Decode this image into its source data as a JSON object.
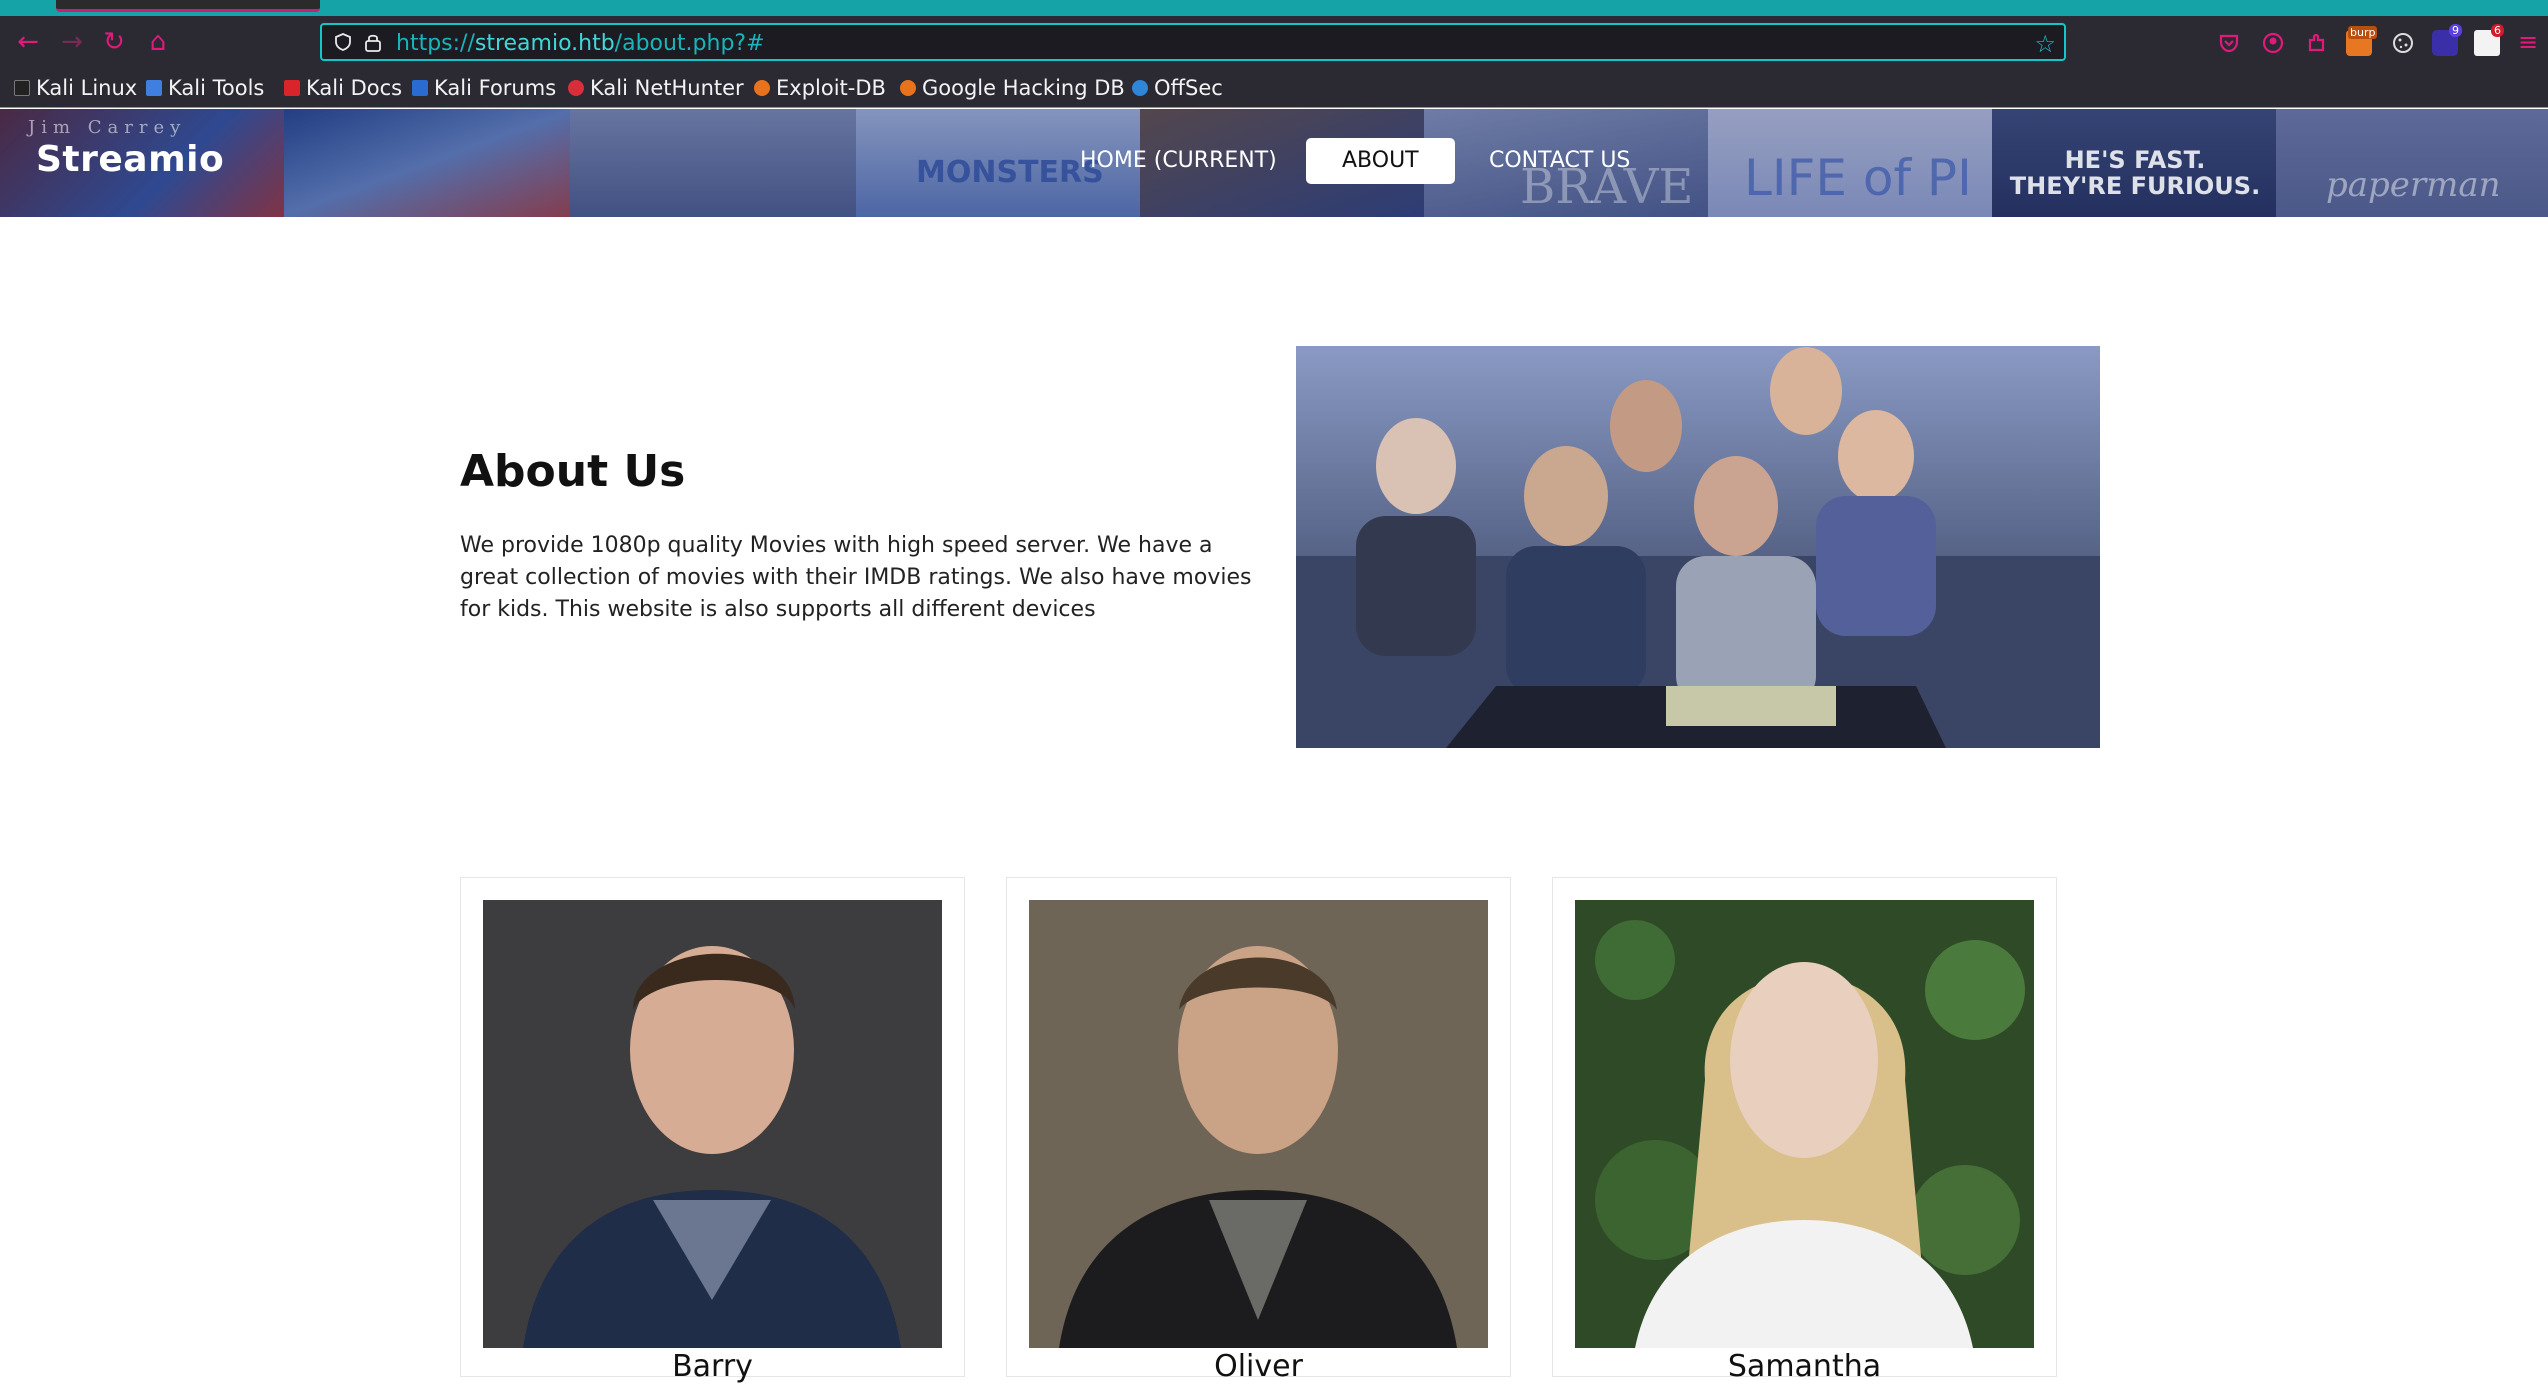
{
  "browser": {
    "url_scheme": "https://",
    "url_host": "streamio.htb",
    "url_path": "/about.php?#",
    "bookmarks": [
      "Kali Linux",
      "Kali Tools",
      "Kali Docs",
      "Kali Forums",
      "Kali NetHunter",
      "Exploit-DB",
      "Google Hacking DB",
      "OffSec"
    ],
    "ext_badges": {
      "burp": "burp",
      "badge_a": "9",
      "badge_b": "6"
    }
  },
  "header": {
    "brand": "Streamio",
    "nav": [
      "HOME (CURRENT)",
      "ABOUT",
      "CONTACT US"
    ],
    "poster_texts": [
      "Jim Carrey",
      "MONSTERS",
      "BRAVE",
      "LIFE of PI",
      "HE'S FAST. THEY'RE FURIOUS.",
      "paperman"
    ]
  },
  "about": {
    "title": "About Us",
    "text": "We provide 1080p quality Movies with high speed server. We have a great collection of movies with their IMDB ratings. We also have movies for kids. This website is also supports all different devices"
  },
  "team": [
    {
      "name": "Barry"
    },
    {
      "name": "Oliver"
    },
    {
      "name": "Samantha"
    }
  ],
  "colors": {
    "accent": "#14c6c8",
    "pink": "#e0197a",
    "chrome": "#2b2a33"
  }
}
